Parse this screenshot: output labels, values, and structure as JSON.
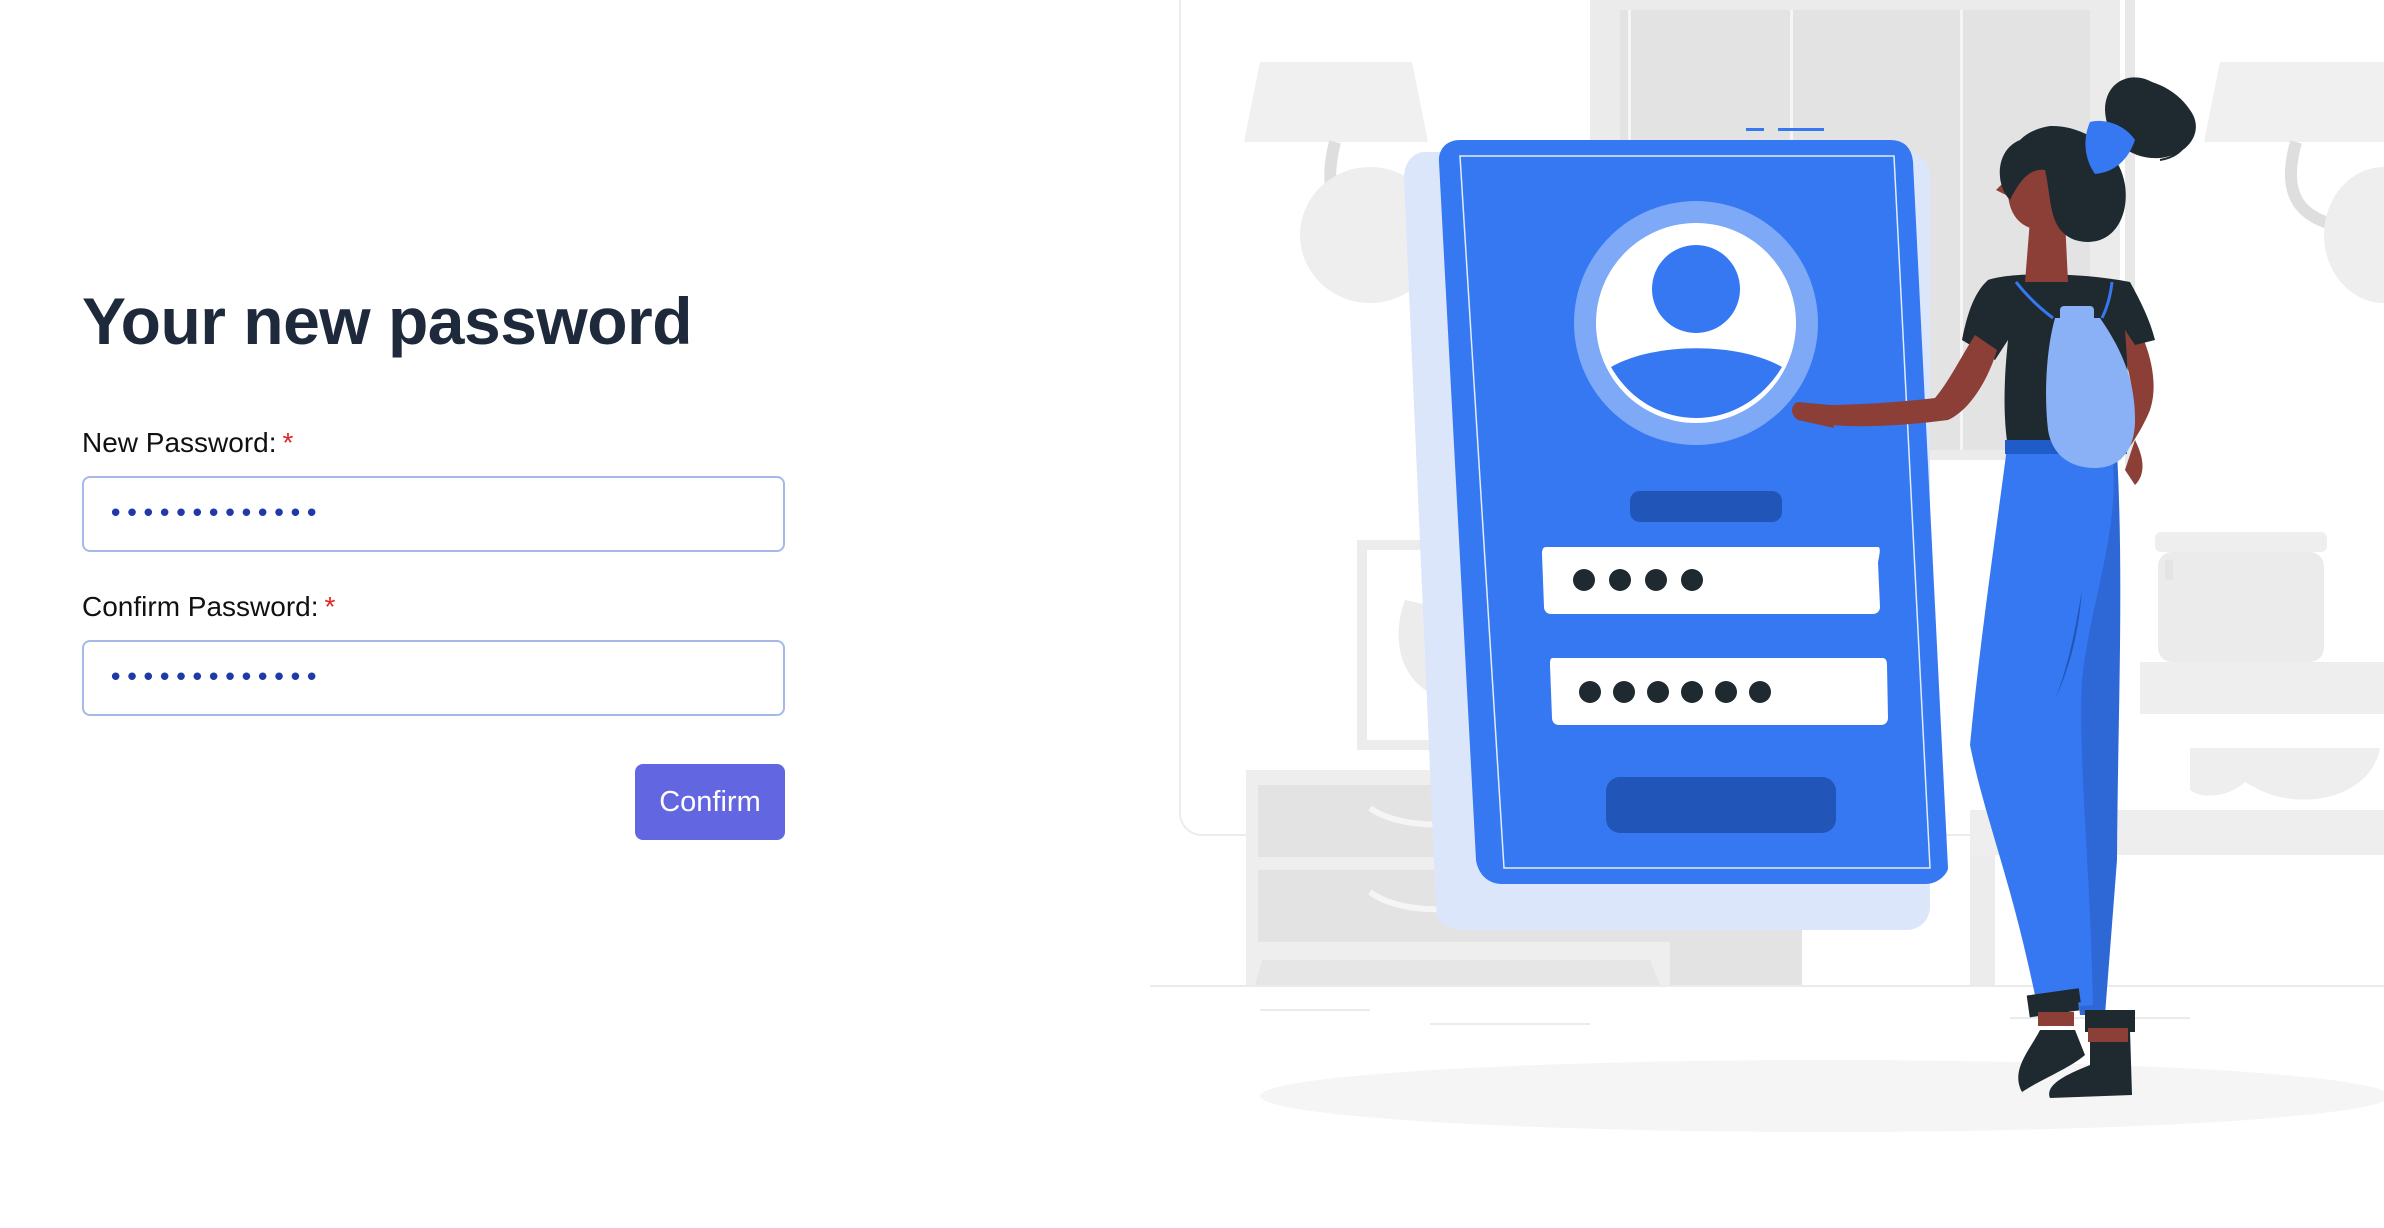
{
  "form": {
    "title": "Your new password",
    "new_password": {
      "label": "New Password:",
      "required_mark": "*",
      "value_masked": "•••••••••••••"
    },
    "confirm_password": {
      "label": "Confirm Password:",
      "required_mark": "*",
      "value_masked": "•••••••••••••"
    },
    "confirm_button_label": "Confirm"
  },
  "illustration": {
    "subject": "person-with-phone-login-screen",
    "colors": {
      "primary_blue": "#3678f2",
      "dark_blue": "#2156b8",
      "light_blue": "#dbe6fb",
      "skin": "#8b3f36",
      "dark": "#1f2a30",
      "background_gray": "#ebebeb"
    }
  },
  "theme": {
    "accent": "#6366e1",
    "input_border": "#a5b8e8",
    "required": "#dc2626",
    "title_color": "#1e293b"
  }
}
